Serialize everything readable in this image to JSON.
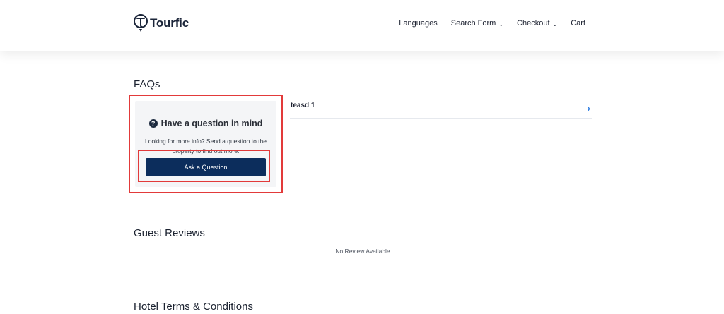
{
  "header": {
    "logo_text": "Tourfic",
    "nav": [
      {
        "label": "Languages",
        "has_dropdown": false
      },
      {
        "label": "Search Form",
        "has_dropdown": true
      },
      {
        "label": "Checkout",
        "has_dropdown": true
      },
      {
        "label": "Cart",
        "has_dropdown": false
      }
    ]
  },
  "faqs": {
    "title": "FAQs",
    "ask_box": {
      "heading": "Have a question in mind",
      "description": "Looking for more info? Send a question to the property to find out more.",
      "button_label": "Ask a Question"
    },
    "items": [
      {
        "question": "teasd 1"
      }
    ]
  },
  "reviews": {
    "title": "Guest Reviews",
    "empty_text": "No Review Available"
  },
  "terms": {
    "title": "Hotel Terms & Conditions"
  },
  "colors": {
    "primary": "#0c2d5c",
    "accent_arrow": "#2f7de1",
    "highlight": "#e23a3a",
    "box_bg": "#f4f5f7"
  },
  "icons": {
    "logo": "tourfic-logo-icon",
    "question": "question-circle-icon",
    "chevron": "chevron-down-icon",
    "faq_arrow": "chevron-right-icon"
  }
}
